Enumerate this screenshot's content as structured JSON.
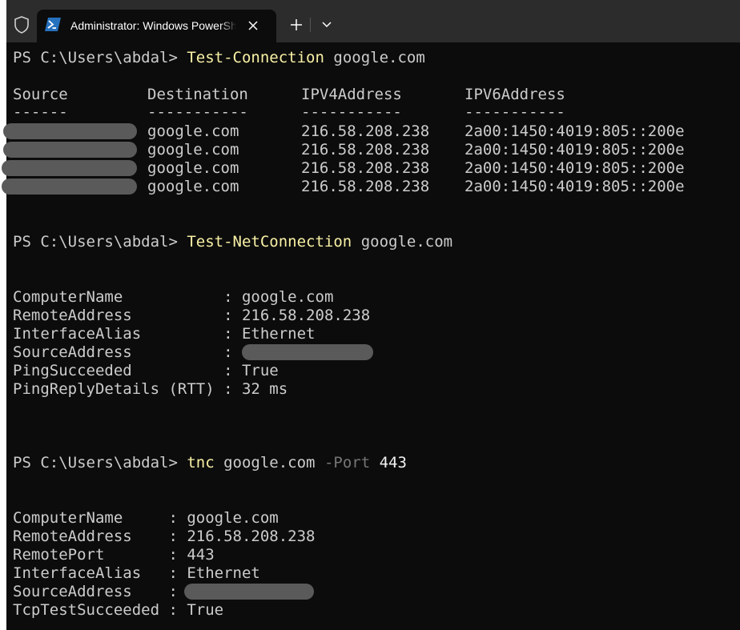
{
  "window": {
    "tab_title": "Administrator: Windows PowerShell",
    "new_tab_icon": "plus-icon",
    "dropdown_icon": "chevron-down-icon",
    "close_icon": "close-icon",
    "shield_icon": "shield-icon"
  },
  "session": {
    "prompt": "PS C:\\Users\\abdal> ",
    "cmd1": {
      "name": "Test-Connection",
      "args": " google.com",
      "headers": [
        "Source",
        "Destination",
        "IPV4Address",
        "IPV6Address"
      ],
      "underlines": [
        "------",
        "-----------",
        "-----------",
        "-----------"
      ],
      "rows": [
        {
          "destination": "google.com",
          "ipv4": "216.58.208.238",
          "ipv6": "2a00:1450:4019:805::200e"
        },
        {
          "destination": "google.com",
          "ipv4": "216.58.208.238",
          "ipv6": "2a00:1450:4019:805::200e"
        },
        {
          "destination": "google.com",
          "ipv4": "216.58.208.238",
          "ipv6": "2a00:1450:4019:805::200e"
        },
        {
          "destination": "google.com",
          "ipv4": "216.58.208.238",
          "ipv6": "2a00:1450:4019:805::200e"
        }
      ]
    },
    "cmd2": {
      "name": "Test-NetConnection",
      "args": " google.com",
      "lines": [
        {
          "label": "ComputerName           ",
          "value": ": google.com"
        },
        {
          "label": "RemoteAddress          ",
          "value": ": 216.58.208.238"
        },
        {
          "label": "InterfaceAlias         ",
          "value": ": Ethernet"
        },
        {
          "label": "SourceAddress          ",
          "value": ":"
        },
        {
          "label": "PingSucceeded          ",
          "value": ": True"
        },
        {
          "label": "PingReplyDetails (RTT) ",
          "value": ": 32 ms"
        }
      ]
    },
    "cmd3": {
      "name": "tnc",
      "args": " google.com ",
      "param": "-Port",
      "param_value": " 443",
      "lines": [
        {
          "label": "ComputerName     ",
          "value": ": google.com"
        },
        {
          "label": "RemoteAddress    ",
          "value": ": 216.58.208.238"
        },
        {
          "label": "RemotePort       ",
          "value": ": 443"
        },
        {
          "label": "InterfaceAlias   ",
          "value": ": Ethernet"
        },
        {
          "label": "SourceAddress    ",
          "value": ":"
        },
        {
          "label": "TcpTestSucceeded ",
          "value": ": True"
        }
      ]
    }
  }
}
